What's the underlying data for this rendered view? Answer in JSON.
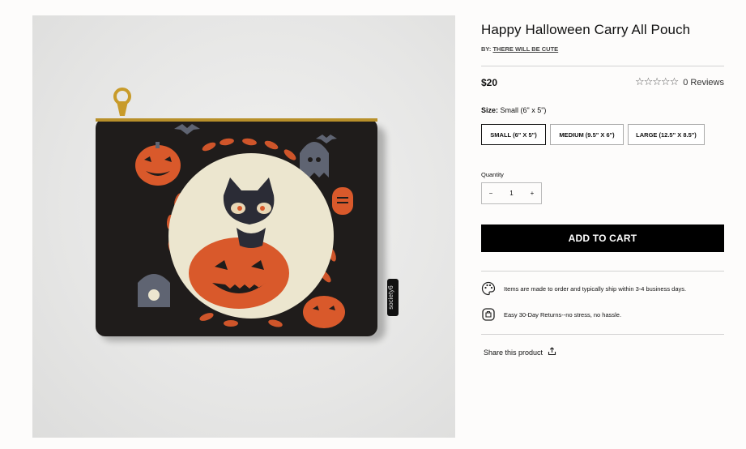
{
  "product": {
    "title": "Happy Halloween Carry All Pouch",
    "by_prefix": "BY: ",
    "artist": "THERE WILL BE CUTE",
    "price": "$20",
    "rating_value": 0,
    "rating_max": 5,
    "reviews": "0 Reviews",
    "pouch_brand_tag": "society6"
  },
  "size": {
    "label": "Size:",
    "selected_value": "Small (6\" x 5\")",
    "options": [
      {
        "label": "SMALL (6\" X 5\")",
        "selected": true
      },
      {
        "label": "MEDIUM (9.5\" X 6\")",
        "selected": false
      },
      {
        "label": "LARGE (12.5\" X 8.5\")",
        "selected": false
      }
    ]
  },
  "quantity": {
    "label": "Quantity",
    "value": "1",
    "minus": "−",
    "plus": "+"
  },
  "cart": {
    "button_label": "ADD TO CART"
  },
  "features": [
    {
      "icon": "palette-icon",
      "text": "Items are made to order and typically ship within 3-4 business days."
    },
    {
      "icon": "returns-icon",
      "text": "Easy 30-Day Returns--no stress, no hassle."
    }
  ],
  "share": {
    "label": "Share this product",
    "icon": "share-icon"
  },
  "colors": {
    "button_bg": "#000000",
    "button_text": "#ffffff",
    "pouch": "#1f1c1b",
    "accent_orange": "#d9592b",
    "cream": "#ece6cf"
  }
}
